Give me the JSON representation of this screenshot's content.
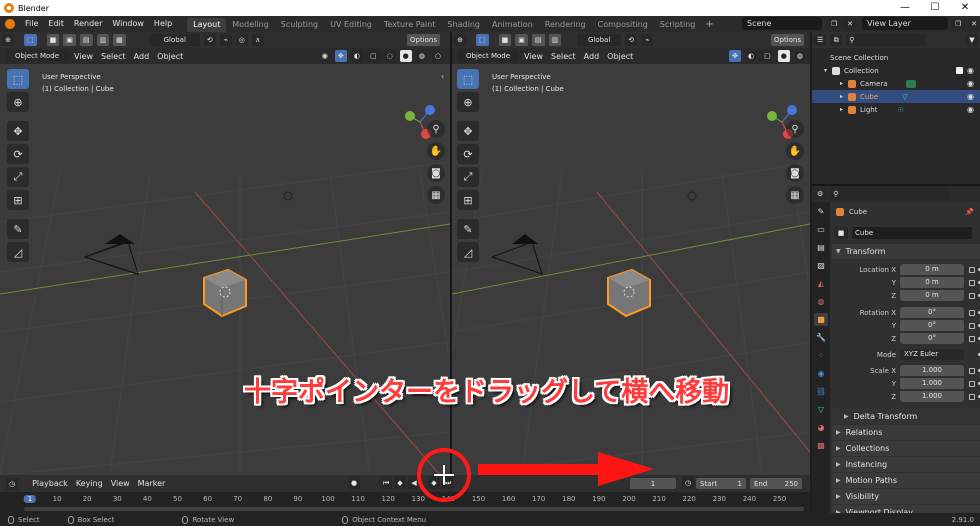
{
  "window": {
    "title": "Blender",
    "minimize": "—",
    "maximize": "☐",
    "close": "✕"
  },
  "menu": [
    "File",
    "Edit",
    "Render",
    "Window",
    "Help"
  ],
  "workspace_tabs": [
    {
      "label": "Layout",
      "active": true
    },
    {
      "label": "Modeling"
    },
    {
      "label": "Sculpting"
    },
    {
      "label": "UV Editing"
    },
    {
      "label": "Texture Paint"
    },
    {
      "label": "Shading"
    },
    {
      "label": "Animation"
    },
    {
      "label": "Rendering"
    },
    {
      "label": "Compositing"
    },
    {
      "label": "Scripting"
    }
  ],
  "add_tab": "+",
  "scene": {
    "name": "Scene"
  },
  "view_layer": {
    "name": "View Layer"
  },
  "viewport_left": {
    "orientation": "Global",
    "options": "Options",
    "mode": "Object Mode",
    "menus": [
      "View",
      "Select",
      "Add",
      "Object"
    ],
    "perspective": "User Perspective",
    "collection": "(1) Collection | Cube"
  },
  "viewport_right": {
    "orientation": "Global",
    "options": "Options",
    "mode": "Object Mode",
    "menus": [
      "View",
      "Select",
      "Add",
      "Object"
    ],
    "perspective": "User Perspective",
    "collection": "(1) Collection | Cube"
  },
  "axes": {
    "x": "X",
    "y": "Y",
    "z": "Z"
  },
  "outliner": {
    "root": "Scene Collection",
    "collection": "Collection",
    "items": [
      {
        "name": "Camera",
        "color": "#e0823a"
      },
      {
        "name": "Cube",
        "color": "#e0823a",
        "selected": true
      },
      {
        "name": "Light",
        "color": "#e0823a"
      }
    ]
  },
  "properties": {
    "object_name": "Cube",
    "data_name": "Cube",
    "transform_label": "Transform",
    "location": {
      "label": "Location X",
      "y_label": "Y",
      "z_label": "Z",
      "x": "0 m",
      "y": "0 m",
      "z": "0 m"
    },
    "rotation": {
      "label": "Rotation X",
      "y_label": "Y",
      "z_label": "Z",
      "x": "0°",
      "y": "0°",
      "z": "0°"
    },
    "mode": {
      "label": "Mode",
      "value": "XYZ Euler"
    },
    "scale": {
      "label": "Scale X",
      "y_label": "Y",
      "z_label": "Z",
      "x": "1.000",
      "y": "1.000",
      "z": "1.000"
    },
    "panels": [
      "Delta Transform",
      "Relations",
      "Collections",
      "Instancing",
      "Motion Paths",
      "Visibility",
      "Viewport Display"
    ]
  },
  "timeline": {
    "menus": [
      "Playback",
      "Keying",
      "View",
      "Marker"
    ],
    "current_frame": "1",
    "start_label": "Start",
    "start": "1",
    "end_label": "End",
    "end": "250",
    "ruler": [
      "1",
      "10",
      "20",
      "30",
      "40",
      "50",
      "60",
      "70",
      "80",
      "90",
      "100",
      "110",
      "120",
      "130",
      "140",
      "150",
      "160",
      "170",
      "180",
      "190",
      "200",
      "210",
      "220",
      "230",
      "240",
      "250"
    ]
  },
  "statusbar": {
    "select": "Select",
    "box_select": "Box Select",
    "rotate_view": "Rotate View",
    "context_menu": "Object Context Menu",
    "version": "2.91.0"
  },
  "annotation": {
    "text": "十字ポインターをドラッグして横へ移動",
    "color": "#ff2222"
  }
}
